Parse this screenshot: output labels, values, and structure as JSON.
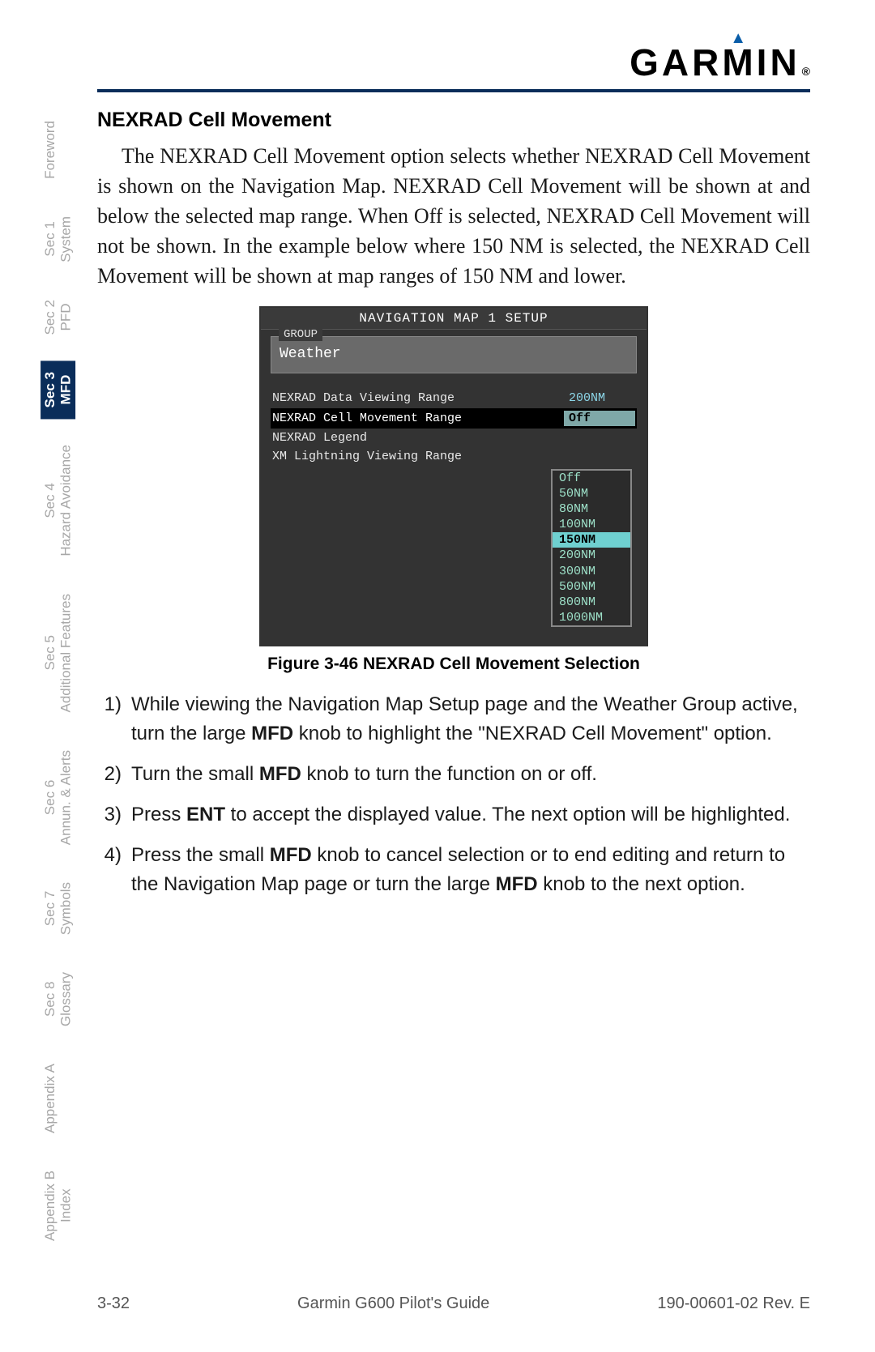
{
  "header": {
    "brand": "GARMIN",
    "reg": "®"
  },
  "section_title": "NEXRAD Cell Movement",
  "body_paragraph": "The NEXRAD Cell Movement option selects whether NEXRAD Cell Movement is shown on the Navigation Map. NEXRAD Cell Movement will be shown at and below the selected map range. When Off is selected, NEXRAD Cell Movement will not be shown. In the example below where 150 NM is selected, the NEXRAD Cell Movement will be shown at map ranges of 150 NM and lower.",
  "screenshot": {
    "title": "NAVIGATION MAP 1 SETUP",
    "group_label": "GROUP",
    "group_value": "Weather",
    "rows": [
      {
        "label": "NEXRAD Data Viewing Range",
        "value": "200NM"
      },
      {
        "label": "NEXRAD Cell Movement Range",
        "value": "Off"
      },
      {
        "label": "NEXRAD Legend",
        "value": ""
      },
      {
        "label": "XM Lightning Viewing Range",
        "value": ""
      }
    ],
    "dropdown": [
      "Off",
      "50NM",
      "80NM",
      "100NM",
      "150NM",
      "200NM",
      "300NM",
      "500NM",
      "800NM",
      "1000NM"
    ],
    "dropdown_selected": "150NM"
  },
  "figure_caption": "Figure 3-46  NEXRAD Cell Movement Selection",
  "steps": [
    {
      "num": "1)",
      "pre": "While viewing the Navigation Map Setup page and the Weather Group active, turn the large ",
      "b1": "MFD",
      "mid": " knob to highlight the \"NEXRAD Cell Movement\" option.",
      "b2": "",
      "post": ""
    },
    {
      "num": "2)",
      "pre": "Turn the small ",
      "b1": "MFD",
      "mid": " knob to turn the function on or off.",
      "b2": "",
      "post": ""
    },
    {
      "num": "3)",
      "pre": "Press ",
      "b1": "ENT",
      "mid": " to accept the displayed value. The next option will be highlighted.",
      "b2": "",
      "post": ""
    },
    {
      "num": "4)",
      "pre": "Press the small ",
      "b1": "MFD",
      "mid": " knob to cancel selection or to end editing and return to the Navigation Map page or turn the large ",
      "b2": "MFD",
      "post": " knob to the next option."
    }
  ],
  "side_tabs": [
    {
      "sec": "",
      "name": "Foreword"
    },
    {
      "sec": "Sec 1",
      "name": "System"
    },
    {
      "sec": "Sec 2",
      "name": "PFD"
    },
    {
      "sec": "Sec 3",
      "name": "MFD"
    },
    {
      "sec": "Sec 4",
      "name": "Hazard Avoidance"
    },
    {
      "sec": "Sec 5",
      "name": "Additional Features"
    },
    {
      "sec": "Sec 6",
      "name": "Annun. & Alerts"
    },
    {
      "sec": "Sec 7",
      "name": "Symbols"
    },
    {
      "sec": "Sec 8",
      "name": "Glossary"
    },
    {
      "sec": "",
      "name": "Appendix A"
    },
    {
      "sec": "Appendix B",
      "name": "Index"
    }
  ],
  "active_tab_index": 3,
  "footer": {
    "page": "3-32",
    "title": "Garmin G600 Pilot's Guide",
    "doc": "190-00601-02  Rev. E"
  }
}
